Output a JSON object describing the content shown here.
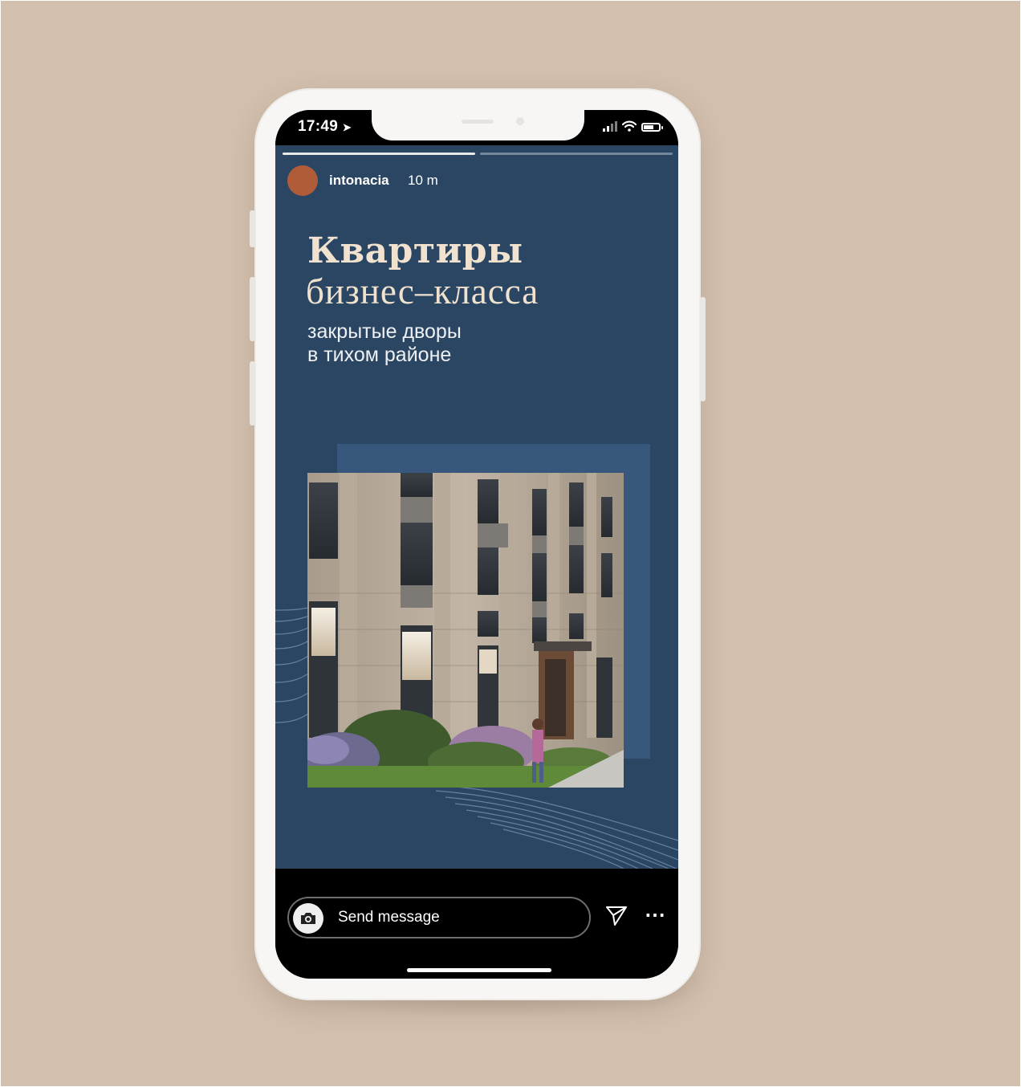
{
  "status_bar": {
    "time": "17:49",
    "location_icon": "location-arrow-icon",
    "signal_icon": "cellular-signal-icon",
    "wifi_icon": "wifi-icon",
    "battery_icon": "battery-icon"
  },
  "story": {
    "progress": [
      1.0,
      0.0
    ],
    "username": "intonacia",
    "posted_ago": "10 m",
    "headline": "Квартиры",
    "subheadline": "бизнес–класса",
    "tagline_line1": "закрытые дворы",
    "tagline_line2": "в тихом районе",
    "colors": {
      "background": "#2a4663",
      "panel": "#37577c",
      "headline": "#f1e2cf",
      "avatar": "#b05c39",
      "page_background": "#d2bfad"
    }
  },
  "reply_bar": {
    "camera_icon": "camera-icon",
    "placeholder": "Send message",
    "send_icon": "paper-plane-icon",
    "more_icon": "more-options-icon"
  }
}
